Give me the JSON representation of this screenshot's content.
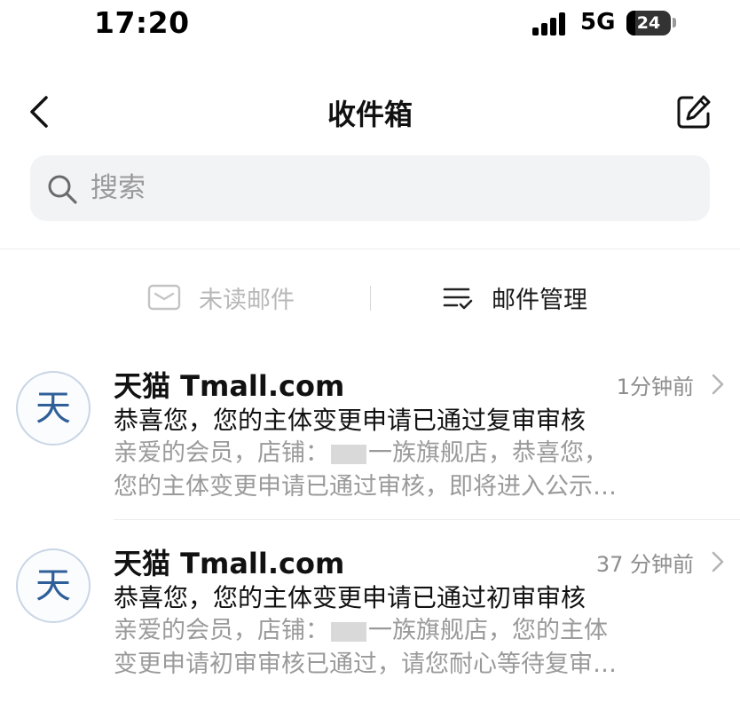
{
  "status_bar": {
    "time": "17:20",
    "network": "5G",
    "battery": "24",
    "battery_level": 0.24
  },
  "nav": {
    "title": "收件箱",
    "back_icon": "chevron-left-icon",
    "compose_icon": "compose-icon"
  },
  "search": {
    "placeholder": "搜索",
    "value": ""
  },
  "filters": {
    "unread_label": "未读邮件",
    "manage_label": "邮件管理"
  },
  "mails": [
    {
      "avatar": "天",
      "sender": "天猫 Tmall.com",
      "time": "1分钟前",
      "subject": "恭喜您，您的主体变更申请已通过复审审核",
      "preview_line1_before": "亲爱的会员，店铺：",
      "preview_line1_after": "一族旗舰店，恭喜您，",
      "preview_line2": "您的主体变更申请已通过审核，即将进入公示…"
    },
    {
      "avatar": "天",
      "sender": "天猫 Tmall.com",
      "time": "37 分钟前",
      "subject": "恭喜您，您的主体变更申请已通过初审审核",
      "preview_line1_before": "亲爱的会员，店铺：",
      "preview_line1_after": "一族旗舰店，您的主体",
      "preview_line2": "变更申请初审审核已通过，请您耐心等待复审…"
    }
  ],
  "colors": {
    "accent_avatar": "#2f5f99",
    "muted_text": "#9a9a9a",
    "search_bg": "#f2f3f5"
  }
}
